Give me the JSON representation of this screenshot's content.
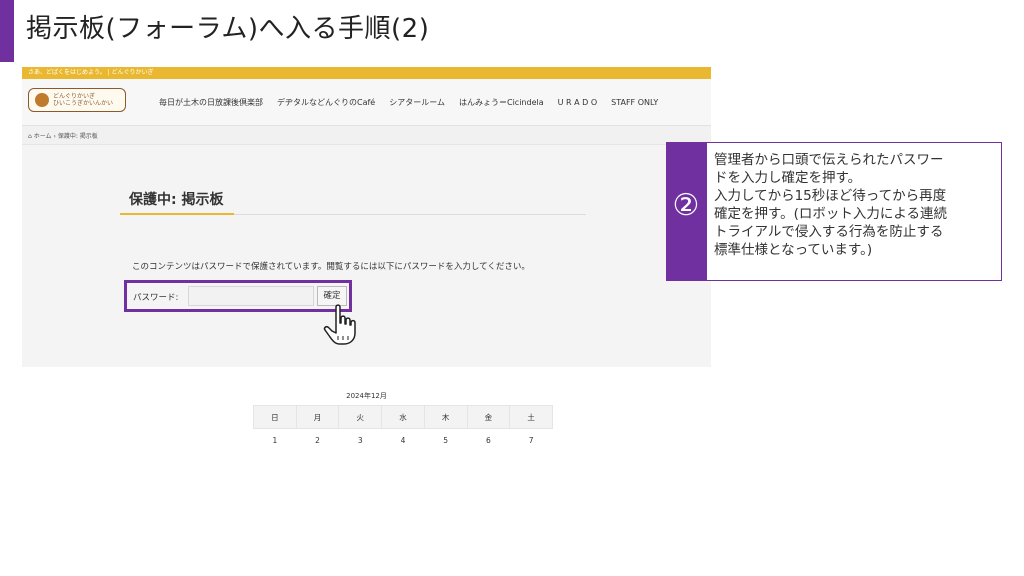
{
  "slide": {
    "title": "掲示板(フォーラム)へ入る手順(2)"
  },
  "site": {
    "topbar_text": "さあ、どばくをはじめよう。 | どんぐりかいぎ",
    "logo_lines": [
      "どんぐりかいぎ",
      "ひいこうぎかいんかい"
    ],
    "nav_items": [
      "毎日が土木の日放課後倶楽部",
      "デヂタルなどんぐりのCafé",
      "シアタールーム",
      "はんみょう＝Cicindela",
      "U R A D O",
      "STAFF ONLY"
    ],
    "breadcrumb": {
      "home": "ホーム",
      "separator": "›",
      "current": "保護中: 掲示板"
    },
    "page_heading": "保護中: 掲示板",
    "protect_message": "このコンテンツはパスワードで保護されています。閲覧するには以下にパスワードを入力してください。",
    "password_label": "パスワード:",
    "password_value": "",
    "submit_label": "確定"
  },
  "calendar": {
    "caption": "2024年12月",
    "headers": [
      "日",
      "月",
      "火",
      "水",
      "木",
      "金",
      "土"
    ],
    "rows": [
      [
        "1",
        "2",
        "3",
        "4",
        "5",
        "6",
        "7"
      ]
    ]
  },
  "callout": {
    "step_number": "②",
    "lines": [
      "管理者から口頭で伝えられたパスワー",
      "ドを入力し確定を押す。",
      "入力してから15秒ほど待ってから再度",
      "確定を押す。(ロボット入力による連続",
      "トライアルで侵入する行為を防止する",
      "標準仕様となっています。)"
    ]
  },
  "colors": {
    "accent_purple": "#7030a0",
    "topbar_yellow": "#eab830"
  }
}
